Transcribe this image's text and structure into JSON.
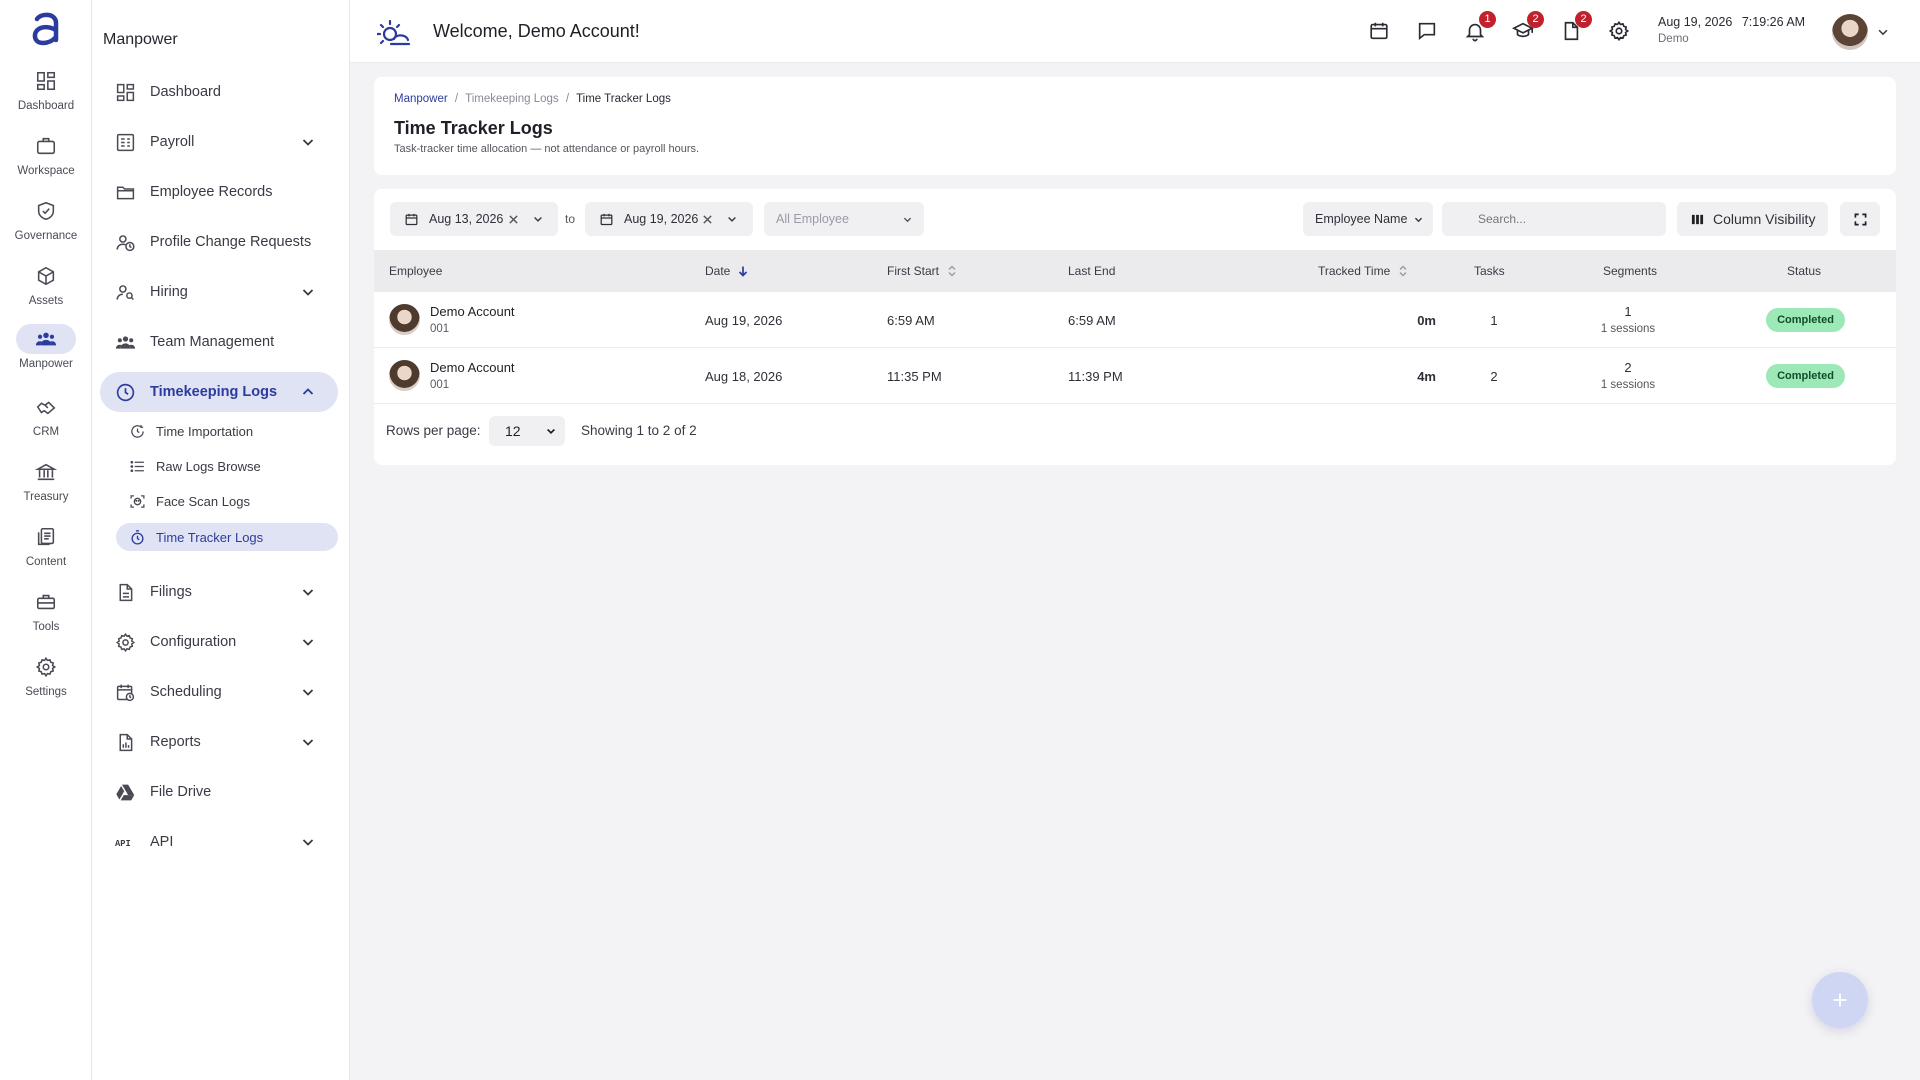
{
  "rail": {
    "items": [
      {
        "label": "Dashboard",
        "icon": "dashboard-icon"
      },
      {
        "label": "Workspace",
        "icon": "briefcase-icon"
      },
      {
        "label": "Governance",
        "icon": "shield-check-icon"
      },
      {
        "label": "Assets",
        "icon": "cube-icon"
      },
      {
        "label": "Manpower",
        "icon": "people-icon"
      },
      {
        "label": "CRM",
        "icon": "handshake-icon"
      },
      {
        "label": "Treasury",
        "icon": "bank-icon"
      },
      {
        "label": "Content",
        "icon": "documents-icon"
      },
      {
        "label": "Tools",
        "icon": "toolbox-icon"
      },
      {
        "label": "Settings",
        "icon": "gear-icon"
      }
    ]
  },
  "sidebar": {
    "title": "Manpower",
    "items": [
      {
        "label": "Dashboard"
      },
      {
        "label": "Payroll"
      },
      {
        "label": "Employee Records"
      },
      {
        "label": "Profile Change Requests"
      },
      {
        "label": "Hiring"
      },
      {
        "label": "Team Management"
      },
      {
        "label": "Timekeeping Logs"
      },
      {
        "label": "Filings"
      },
      {
        "label": "Configuration"
      },
      {
        "label": "Scheduling"
      },
      {
        "label": "Reports"
      },
      {
        "label": "File Drive"
      },
      {
        "label": "API"
      }
    ],
    "sub_items": [
      {
        "label": "Time Importation"
      },
      {
        "label": "Raw Logs Browse"
      },
      {
        "label": "Face Scan Logs"
      },
      {
        "label": "Time Tracker Logs"
      }
    ]
  },
  "header": {
    "welcome": "Welcome, Demo Account!",
    "badges": {
      "notifications": "1",
      "courses": "2",
      "requests": "2"
    },
    "date": "Aug 19, 2026",
    "time": "7:19:26 AM",
    "account": "Demo"
  },
  "page": {
    "breadcrumb": {
      "root": "Manpower",
      "middle": "Timekeeping Logs",
      "current": "Time Tracker Logs",
      "separator": "/"
    },
    "title": "Time Tracker Logs",
    "subtitle": "Task-tracker time allocation — not attendance or payroll hours."
  },
  "filters": {
    "date_from": "Aug 13, 2026",
    "to_label": "to",
    "date_to": "Aug 19, 2026",
    "employee_placeholder": "All Employee",
    "sort_field": "Employee Name",
    "search_placeholder": "Search...",
    "column_visibility": "Column Visibility"
  },
  "table": {
    "columns": [
      "Employee",
      "Date",
      "First Start",
      "Last End",
      "Tracked Time",
      "Tasks",
      "Segments",
      "Status"
    ],
    "rows": [
      {
        "name": "Demo Account",
        "id": "001",
        "date": "Aug 19, 2026",
        "first_start": "6:59 AM",
        "last_end": "6:59 AM",
        "tracked": "0m",
        "tasks": "1",
        "segments": "1",
        "sessions": "1 sessions",
        "status": "Completed"
      },
      {
        "name": "Demo Account",
        "id": "001",
        "date": "Aug 18, 2026",
        "first_start": "11:35 PM",
        "last_end": "11:39 PM",
        "tracked": "4m",
        "tasks": "2",
        "segments": "2",
        "sessions": "1 sessions",
        "status": "Completed"
      }
    ]
  },
  "pagination": {
    "rows_per_page_label": "Rows per page:",
    "rows_per_page": "12",
    "showing": "Showing 1 to 2 of 2"
  },
  "colors": {
    "accent": "#2c3c9e",
    "active_bg": "#dfe3f3",
    "badge_red": "#c1202d",
    "status_green": "#9ce8b6"
  }
}
